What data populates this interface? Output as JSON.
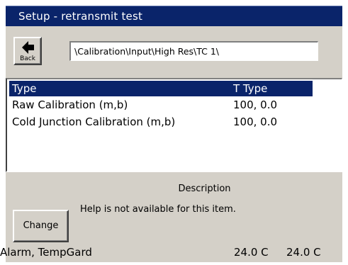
{
  "window": {
    "title": "Setup - retransmit test"
  },
  "toolbar": {
    "back_label": "Back",
    "back_icon": "arrow-left-icon",
    "path": "\\Calibration\\Input\\High Res\\TC 1\\"
  },
  "table": {
    "header": {
      "name": "Type",
      "value": "T Type"
    },
    "rows": [
      {
        "name": "Raw Calibration (m,b)",
        "value": "100, 0.0"
      },
      {
        "name": "Cold Junction Calibration (m,b)",
        "value": "100, 0.0"
      }
    ]
  },
  "description": {
    "heading": "Description",
    "text": "Help is not available for this item."
  },
  "actions": {
    "change_label": "Change"
  },
  "status": {
    "alarm": "Alarm, TempGard",
    "temp1": "24.0 C",
    "temp2": "24.0 C"
  },
  "colors": {
    "titlebar": "#0a246a",
    "selection": "#0a246a",
    "panel": "#d4d0c8"
  }
}
